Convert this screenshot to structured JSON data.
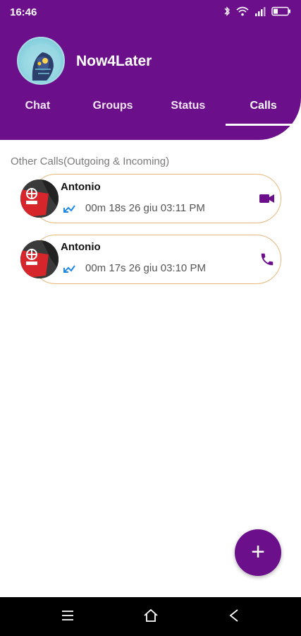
{
  "statusbar": {
    "time": "16:46"
  },
  "app": {
    "title": "Now4Later"
  },
  "tabs": [
    {
      "label": "Chat"
    },
    {
      "label": "Groups"
    },
    {
      "label": "Status"
    },
    {
      "label": "Calls",
      "active": true
    }
  ],
  "section": {
    "label": "Other Calls(Outgoing & Incoming)"
  },
  "calls": [
    {
      "name": "Antonio",
      "info": "00m 18s 26 giu 03:11 PM",
      "direction": "outgoing",
      "type": "video-icon"
    },
    {
      "name": "Antonio",
      "info": "00m 17s 26 giu 03:10 PM",
      "direction": "outgoing",
      "type": "phone-icon"
    }
  ],
  "fab": {
    "label": "+"
  },
  "colors": {
    "primary": "#6b0f8a",
    "card_border": "#e8b87a",
    "arrow": "#1e88e5"
  }
}
